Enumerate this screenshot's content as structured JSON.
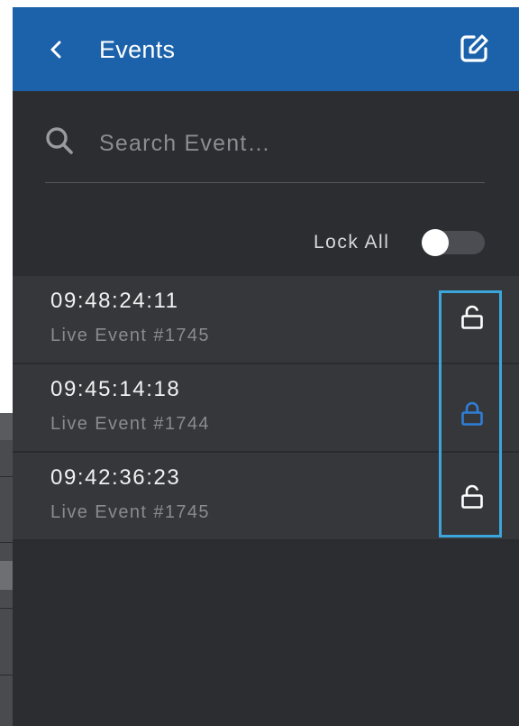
{
  "header": {
    "back_icon": "chevron-left-icon",
    "title": "Events",
    "edit_icon": "edit-icon"
  },
  "search": {
    "icon": "search-icon",
    "placeholder": "Search Event…",
    "value": ""
  },
  "lock_all": {
    "label": "Lock All",
    "enabled": false
  },
  "events": [
    {
      "time": "09:48:24:11",
      "name": "Live Event #1745",
      "locked": false,
      "lock_icon": "unlock-icon"
    },
    {
      "time": "09:45:14:18",
      "name": "Live Event #1744",
      "locked": true,
      "lock_icon": "lock-icon"
    },
    {
      "time": "09:42:36:23",
      "name": "Live Event #1745",
      "locked": false,
      "lock_icon": "unlock-icon"
    }
  ],
  "colors": {
    "header_bg": "#1c62ab",
    "panel_bg": "#2c2d31",
    "row_bg": "#35373b",
    "locked_icon": "#2f7fd6",
    "unlocked_icon": "#ffffff",
    "highlight": "#3aa6dc"
  }
}
